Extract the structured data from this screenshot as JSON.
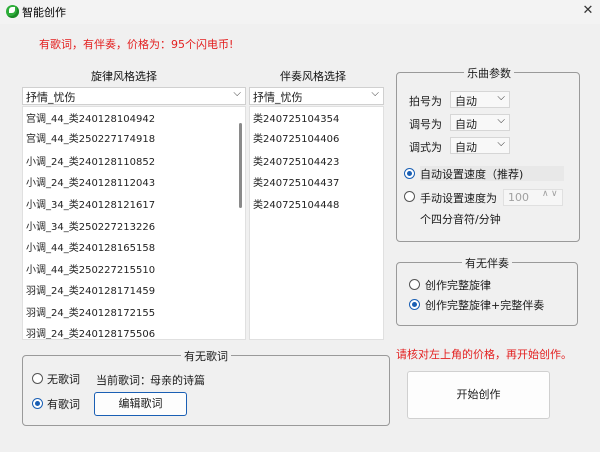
{
  "window": {
    "title": "智能创作",
    "close_label": "✕"
  },
  "price_notice": "有歌词，有伴奏，价格为：95个闪电币!",
  "melody": {
    "heading": "旋律风格选择",
    "selected": "抒情_忧伤",
    "items": [
      "宫调_44_类240128104942",
      "宫调_44_类250227174918",
      "小调_24_类240128110852",
      "小调_24_类240128112043",
      "小调_34_类240128121617",
      "小调_34_类250227213226",
      "小调_44_类240128165158",
      "小调_44_类250227215510",
      "羽调_24_类240128171459",
      "羽调_24_类240128172155",
      "羽调_24_类240128175506"
    ]
  },
  "accompaniment": {
    "heading": "伴奏风格选择",
    "selected": "抒情_忧伤",
    "items": [
      "类240725104354",
      "类240725104406",
      "类240725104423",
      "类240725104437",
      "类240725104448"
    ]
  },
  "music_params": {
    "title": "乐曲参数",
    "meter_label": "拍号为",
    "meter_value": "自动",
    "key_label": "调号为",
    "key_value": "自动",
    "mode_label": "调式为",
    "mode_value": "自动",
    "auto_speed_label": "自动设置速度（推荐)",
    "manual_speed_label": "手动设置速度为",
    "speed_value": "100",
    "speed_unit": "个四分音符/分钟"
  },
  "accomp_group": {
    "title": "有无伴奏",
    "option1": "创作完整旋律",
    "option2": "创作完整旋律+完整伴奏"
  },
  "lyrics_group": {
    "title": "有无歌词",
    "no_lyrics": "无歌词",
    "has_lyrics": "有歌词",
    "current_label": "当前歌词：",
    "current_value": "母亲的诗篇",
    "edit_button": "编辑歌词"
  },
  "bottom_warning": "请核对左上角的价格，再开始创作。",
  "start_button": "开始创作",
  "colors": {
    "warning": "#e32020",
    "accent": "#1a5fb4",
    "app_icon": "#2eae3a"
  }
}
